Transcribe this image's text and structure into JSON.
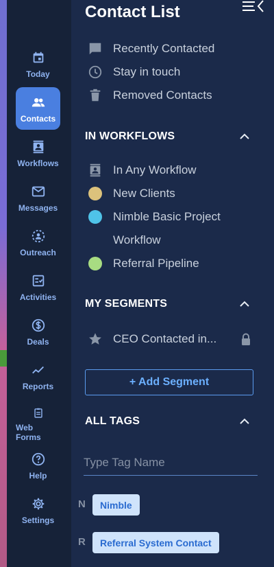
{
  "sidebar": {
    "items": [
      {
        "label": "Today",
        "icon": "calendar-icon"
      },
      {
        "label": "Contacts",
        "icon": "people-icon"
      },
      {
        "label": "Workflows",
        "icon": "contact-card-icon"
      },
      {
        "label": "Messages",
        "icon": "mail-icon"
      },
      {
        "label": "Outreach",
        "icon": "outreach-icon"
      },
      {
        "label": "Activities",
        "icon": "checklist-icon"
      },
      {
        "label": "Deals",
        "icon": "dollar-icon"
      },
      {
        "label": "Reports",
        "icon": "trend-icon"
      },
      {
        "label": "Web Forms",
        "icon": "clipboard-icon"
      },
      {
        "label": "Help",
        "icon": "help-icon"
      },
      {
        "label": "Settings",
        "icon": "gear-icon"
      }
    ],
    "active": "Contacts"
  },
  "panel": {
    "title": "Contact List",
    "quick_links": [
      {
        "label": "Recently Contacted",
        "icon": "chat-icon"
      },
      {
        "label": "Stay in touch",
        "icon": "clock-icon"
      },
      {
        "label": "Removed Contacts",
        "icon": "trash-icon"
      }
    ],
    "workflows": {
      "heading": "IN WORKFLOWS",
      "items": [
        {
          "label": "In Any Workflow",
          "icon": "contact-card-icon"
        },
        {
          "label": "New Clients",
          "color": "#dcc27c"
        },
        {
          "label": "Nimble Basic Project",
          "label2": "Workflow",
          "color": "#4fc3e8"
        },
        {
          "label": "Referral Pipeline",
          "color": "#a8dc82"
        }
      ]
    },
    "segments": {
      "heading": "MY SEGMENTS",
      "items": [
        {
          "label": "CEO Contacted in...",
          "icon": "star-icon"
        }
      ],
      "add_label": "+ Add Segment"
    },
    "tags": {
      "heading": "ALL TAGS",
      "placeholder": "Type Tag Name",
      "groups": [
        {
          "letter": "N",
          "tag": "Nimble"
        },
        {
          "letter": "R",
          "tag": "Referral System Contact"
        }
      ]
    }
  },
  "colors": {
    "accent": "#4a7fe0",
    "rail_bg": "#162238",
    "panel_bg": "#1b2a4a",
    "link": "#6cb0ff"
  }
}
